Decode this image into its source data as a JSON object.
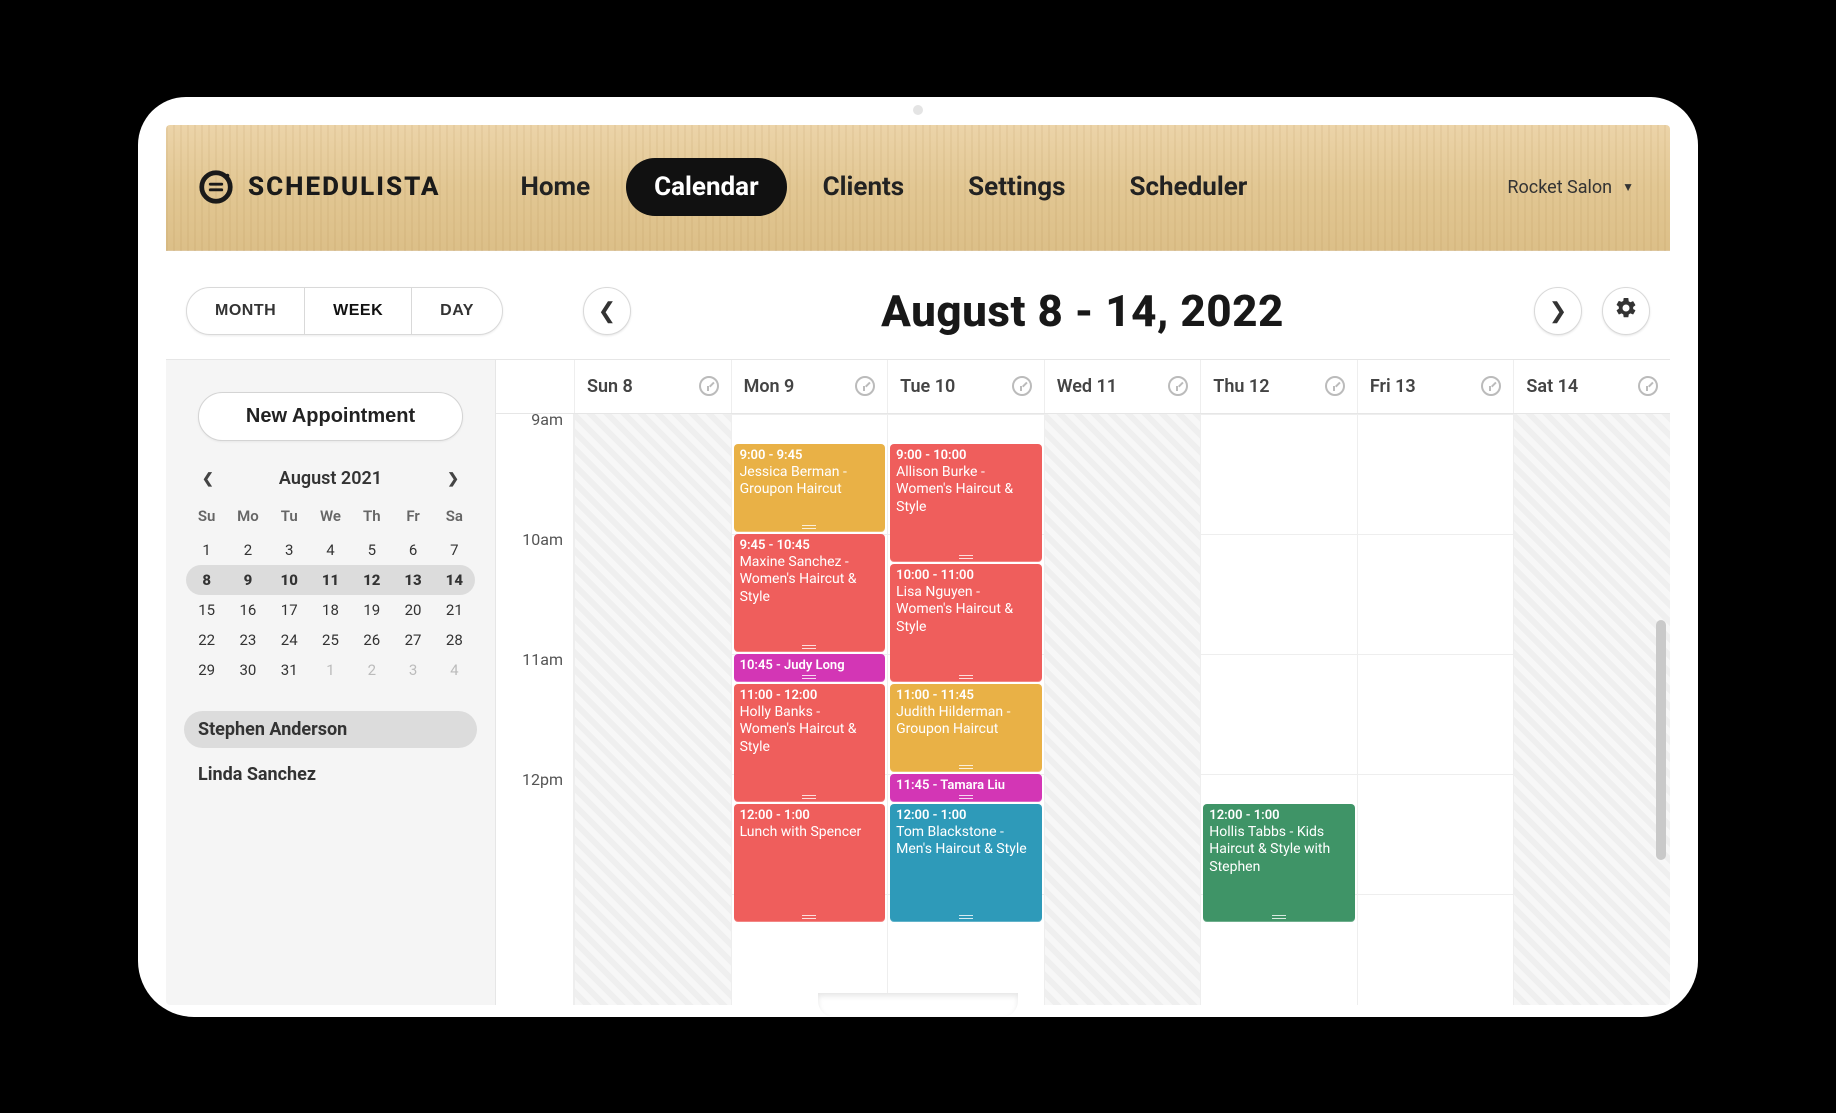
{
  "brand": "SCHEDULISTA",
  "nav": {
    "home": "Home",
    "calendar": "Calendar",
    "clients": "Clients",
    "settings": "Settings",
    "scheduler": "Scheduler"
  },
  "account": {
    "name": "Rocket Salon"
  },
  "toolbar": {
    "views": {
      "month": "MONTH",
      "week": "WEEK",
      "day": "DAY"
    },
    "date_range": "August 8 - 14, 2022"
  },
  "sidebar": {
    "new_appt": "New Appointment",
    "minical": {
      "title": "August 2021",
      "dow": [
        "Su",
        "Mo",
        "Tu",
        "We",
        "Th",
        "Fr",
        "Sa"
      ],
      "rows": [
        [
          1,
          2,
          3,
          4,
          5,
          6,
          7
        ],
        [
          8,
          9,
          10,
          11,
          12,
          13,
          14
        ],
        [
          15,
          16,
          17,
          18,
          19,
          20,
          21
        ],
        [
          22,
          23,
          24,
          25,
          26,
          27,
          28
        ],
        [
          29,
          30,
          31,
          1,
          2,
          3,
          4
        ]
      ],
      "highlight_row": 1,
      "other_month_start": {
        "row": 4,
        "col": 3
      }
    },
    "staff": [
      {
        "name": "Stephen Anderson",
        "selected": true
      },
      {
        "name": "Linda Sanchez",
        "selected": false
      }
    ]
  },
  "week": {
    "hours": [
      "9am",
      "10am",
      "11am",
      "12pm"
    ],
    "pixels_per_hour": 120,
    "start_minute": 525,
    "days": [
      {
        "label": "Sun 8",
        "off": true,
        "events": []
      },
      {
        "label": "Mon 9",
        "off": false,
        "events": [
          {
            "start": 540,
            "end": 585,
            "color": "#e9b146",
            "time": "9:00 - 9:45",
            "title": "Jessica Berman - Groupon Haircut"
          },
          {
            "start": 585,
            "end": 645,
            "color": "#ef5e5c",
            "time": "9:45 - 10:45",
            "title": "Maxine Sanchez - Women's Haircut & Style"
          },
          {
            "start": 645,
            "end": 660,
            "color": "#d336b5",
            "time": "10:45 - Judy Long",
            "title": ""
          },
          {
            "start": 660,
            "end": 720,
            "color": "#ef5e5c",
            "time": "11:00 - 12:00",
            "title": "Holly Banks - Women's Haircut & Style"
          },
          {
            "start": 720,
            "end": 780,
            "color": "#ef5e5c",
            "time": "12:00 - 1:00",
            "title": "Lunch with Spencer"
          }
        ]
      },
      {
        "label": "Tue 10",
        "off": false,
        "events": [
          {
            "start": 540,
            "end": 600,
            "color": "#ef5e5c",
            "time": "9:00 - 10:00",
            "title": "Allison Burke - Women's Haircut & Style"
          },
          {
            "start": 600,
            "end": 660,
            "color": "#ef5e5c",
            "time": "10:00 - 11:00",
            "title": "Lisa Nguyen - Women's Haircut & Style"
          },
          {
            "start": 660,
            "end": 705,
            "color": "#e9b146",
            "time": "11:00 - 11:45",
            "title": "Judith Hilderman - Groupon Haircut"
          },
          {
            "start": 705,
            "end": 720,
            "color": "#d336b5",
            "time": "11:45 - Tamara Liu",
            "title": ""
          },
          {
            "start": 720,
            "end": 780,
            "color": "#2e9ab9",
            "time": "12:00 - 1:00",
            "title": "Tom Blackstone - Men's Haircut & Style"
          }
        ]
      },
      {
        "label": "Wed 11",
        "off": true,
        "events": []
      },
      {
        "label": "Thu 12",
        "off": false,
        "events": [
          {
            "start": 720,
            "end": 780,
            "color": "#3f9467",
            "time": "12:00 - 1:00",
            "title": "Hollis Tabbs - Kids Haircut & Style with Stephen"
          }
        ]
      },
      {
        "label": "Fri 13",
        "off": false,
        "events": []
      },
      {
        "label": "Sat 14",
        "off": true,
        "events": []
      }
    ]
  }
}
